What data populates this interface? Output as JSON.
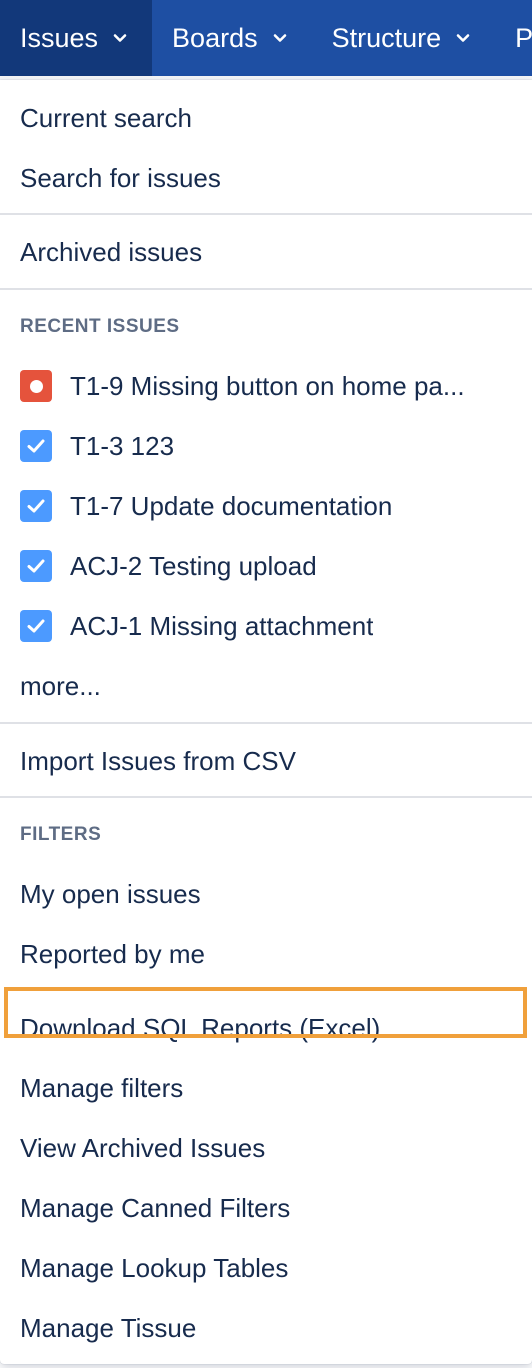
{
  "nav": {
    "items": [
      {
        "label": "Issues",
        "active": true
      },
      {
        "label": "Boards",
        "active": false
      },
      {
        "label": "Structure",
        "active": false
      },
      {
        "label": "P",
        "active": false
      }
    ]
  },
  "menu": {
    "top": {
      "current_search": "Current search",
      "search_for_issues": "Search for issues",
      "archived_issues": "Archived issues"
    },
    "recent": {
      "heading": "RECENT ISSUES",
      "items": [
        {
          "icon": "bug-icon",
          "label": "T1-9 Missing button on home pa..."
        },
        {
          "icon": "task-icon",
          "label": "T1-3 123"
        },
        {
          "icon": "task-icon",
          "label": "T1-7 Update documentation"
        },
        {
          "icon": "task-icon",
          "label": "ACJ-2 Testing upload"
        },
        {
          "icon": "task-icon",
          "label": "ACJ-1 Missing attachment"
        }
      ],
      "more": "more..."
    },
    "import_csv": "Import Issues from CSV",
    "filters": {
      "heading": "FILTERS",
      "my_open": "My open issues",
      "reported_by_me": "Reported by me",
      "download_sql": "Download SQL Reports (Excel)",
      "manage_filters": "Manage filters",
      "view_archived": "View Archived Issues",
      "manage_canned": "Manage Canned Filters",
      "manage_lookup": "Manage Lookup Tables",
      "manage_tissue": "Manage Tissue"
    }
  },
  "colors": {
    "nav_bg": "#1e4fa3",
    "nav_active": "#12387a",
    "bug": "#e5533c",
    "task": "#4c9aff",
    "highlight": "#f0a03b"
  }
}
